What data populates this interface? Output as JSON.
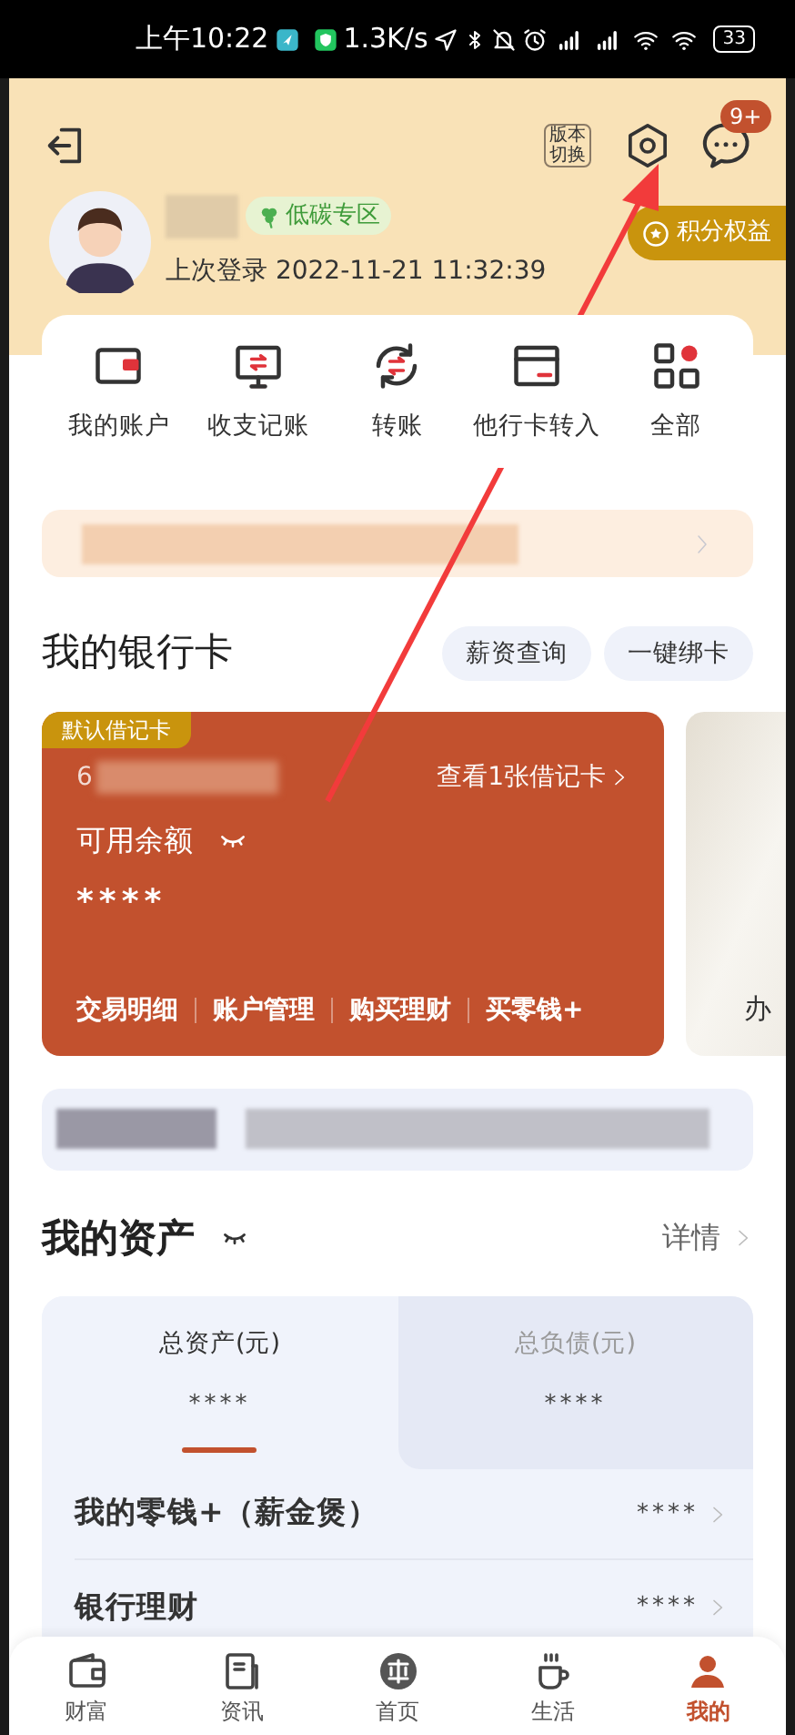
{
  "status_bar": {
    "time": "上午10:22",
    "speed": "1.3K/s",
    "battery": "33"
  },
  "header": {
    "version_switch": [
      "版本",
      "切换"
    ],
    "message_badge": "9+"
  },
  "profile": {
    "tag": "低碳专区",
    "last_login": "上次登录 2022-11-21 11:32:39",
    "points": "积分权益"
  },
  "quick_actions": [
    {
      "kind": "wallet",
      "label": "我的账户"
    },
    {
      "kind": "monitor",
      "label": "收支记账"
    },
    {
      "kind": "transfer",
      "label": "转账"
    },
    {
      "kind": "card",
      "label": "他行卡转入"
    },
    {
      "kind": "grid",
      "label": "全部"
    }
  ],
  "bank_cards": {
    "title": "我的银行卡",
    "buttons": [
      "薪资查询",
      "一键绑卡"
    ],
    "card": {
      "tag": "默认借记卡",
      "number": "6",
      "link": "查看1张借记卡",
      "balance_label": "可用余额",
      "balance": "****",
      "actions": [
        "交易明细",
        "账户管理",
        "购买理财",
        "买零钱+"
      ]
    },
    "next_card": "办"
  },
  "assets": {
    "title": "我的资产",
    "detail": "详情",
    "tabs": [
      {
        "label": "总资产(元)",
        "value": "****",
        "selected": true
      },
      {
        "label": "总负债(元)",
        "value": "****",
        "selected": false
      }
    ],
    "rows": [
      {
        "label": "我的零钱+（薪金煲）",
        "value": "****"
      },
      {
        "label": "银行理财",
        "value": "****"
      }
    ]
  },
  "tab_bar": [
    {
      "kind": "wallet",
      "label": "财富",
      "selected": false
    },
    {
      "kind": "news",
      "label": "资讯",
      "selected": false
    },
    {
      "kind": "logo",
      "label": "首页",
      "selected": false
    },
    {
      "kind": "cup",
      "label": "生活",
      "selected": false
    },
    {
      "kind": "person",
      "label": "我的",
      "selected": true
    }
  ]
}
